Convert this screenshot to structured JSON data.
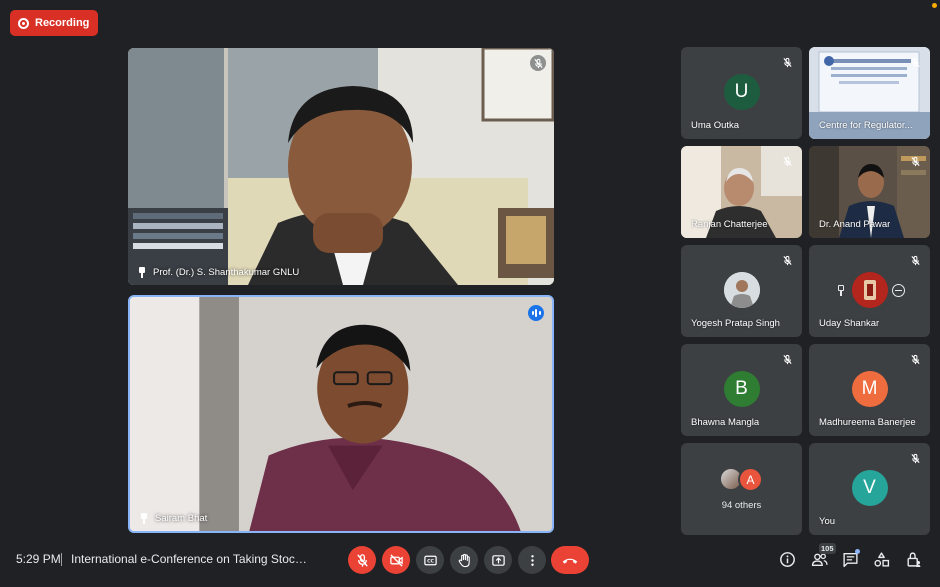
{
  "recording": {
    "label": "Recording"
  },
  "main_tiles": [
    {
      "name": "Prof. (Dr.) S. Shanthakumar GNLU"
    },
    {
      "name": "Sairam Bhat"
    }
  ],
  "participants": [
    {
      "name": "Uma Outka",
      "initial": "U",
      "avatar_color": "#1e5c40"
    },
    {
      "name": "Centre for Regulator..."
    },
    {
      "name": "Ranjan Chatterjee"
    },
    {
      "name": "Dr. Anand Pawar"
    },
    {
      "name": "Yogesh Pratap Singh"
    },
    {
      "name": "Uday Shankar"
    },
    {
      "name": "Bhawna Mangla",
      "initial": "B",
      "avatar_color": "#2e7d32"
    },
    {
      "name": "Madhureema Banerjee",
      "initial": "M",
      "avatar_color": "#ef6c3e"
    },
    {
      "others_initial": "A",
      "others_label": "94 others"
    },
    {
      "name": "You",
      "initial": "V",
      "avatar_color": "#26a69a"
    }
  ],
  "bottom": {
    "time": "5:29 PM",
    "meeting_title": "International e-Conference on Taking Stock of ...",
    "participants_count": "105"
  },
  "colors": {
    "accent": "#8ab4f8",
    "danger": "#ea4335",
    "tile": "#3c4043",
    "background": "#202124"
  }
}
